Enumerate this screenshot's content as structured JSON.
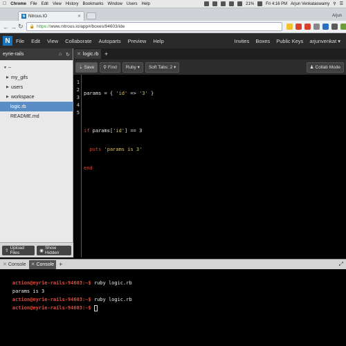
{
  "mac_menu": {
    "app": "Chrome",
    "items": [
      "File",
      "Edit",
      "View",
      "History",
      "Bookmarks",
      "Window",
      "Users",
      "Help"
    ],
    "battery": "21%",
    "clock": "Fri 4:16 PM",
    "user": "Arjun Venkataswamy"
  },
  "browser": {
    "tab_title": "Nitrous.IO",
    "favicon": "N",
    "profile": "Arjun",
    "url_scheme": "https://",
    "url_rest": "www.nitrous.io/app#/boxes/94603/ide"
  },
  "app_header": {
    "logo": "N",
    "menu": [
      "File",
      "Edit",
      "View",
      "Collaborate",
      "Autoparts",
      "Preview",
      "Help"
    ],
    "right_menu": [
      "Invites",
      "Boxes",
      "Public Keys",
      "arjunvenkat ▾"
    ]
  },
  "sidebar": {
    "box_name": "eyrie-rails",
    "root": "~",
    "folders": [
      "my_gifs",
      "users",
      "workspace"
    ],
    "files": [
      "logic.rb",
      "README.md"
    ],
    "selected": "logic.rb",
    "upload_label": "Upload Files",
    "show_hidden_label": "Show Hidden"
  },
  "editor": {
    "tab_label": "logic.rb",
    "toolbar": {
      "save": "Save",
      "find": "Find",
      "language": "Ruby ▾",
      "tabs": "Soft Tabs: 2 ▾",
      "collab": "Collab Mode"
    },
    "line_numbers": [
      "1",
      "2",
      "3",
      "4",
      "5"
    ],
    "code_lines": [
      "params = { 'id' => '3' }",
      "",
      "if params['id'] == 3",
      "  puts 'params is 3'",
      "end"
    ]
  },
  "console": {
    "tabs": [
      "Console",
      "Console"
    ],
    "active_index": 1,
    "lines": [
      {
        "prompt": "action@eyrie-rails-94603:~$",
        "text": " ruby logic.rb"
      },
      {
        "prompt": "",
        "text": "params is 3"
      },
      {
        "prompt": "action@eyrie-rails-94603:~$",
        "text": " ruby logic.rb"
      },
      {
        "prompt": "action@eyrie-rails-94603:~$",
        "text": " "
      }
    ]
  },
  "colors": {
    "brand": "#1a75bc",
    "selection": "#5a8cc6",
    "prompt": "#e24a3b",
    "keyword": "#d04b3c",
    "string": "#d8c36a"
  }
}
